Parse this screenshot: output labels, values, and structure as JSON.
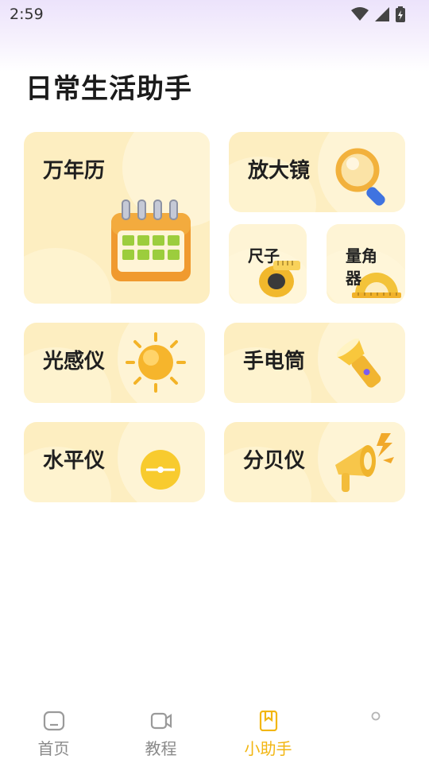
{
  "status_bar": {
    "time": "2:59",
    "icons": [
      "wifi-icon",
      "signal-icon",
      "battery-icon"
    ]
  },
  "page": {
    "title": "日常生活助手"
  },
  "tools": {
    "calendar": {
      "label": "万年历",
      "icon": "calendar-icon"
    },
    "magnifier": {
      "label": "放大镜",
      "icon": "magnifier-icon"
    },
    "ruler": {
      "label": "尺子",
      "icon": "tape-measure-icon"
    },
    "protractor": {
      "label": "量角器",
      "icon": "protractor-icon"
    },
    "light_meter": {
      "label": "光感仪",
      "icon": "sun-icon"
    },
    "flashlight": {
      "label": "手电筒",
      "icon": "flashlight-icon"
    },
    "level": {
      "label": "水平仪",
      "icon": "level-icon"
    },
    "decibel": {
      "label": "分贝仪",
      "icon": "megaphone-icon"
    }
  },
  "nav": {
    "items": [
      {
        "label": "首页",
        "icon": "home-icon"
      },
      {
        "label": "教程",
        "icon": "video-icon"
      },
      {
        "label": "小助手",
        "icon": "bookmark-icon",
        "active": true
      }
    ]
  },
  "colors": {
    "card_bg": "#fdeec1",
    "accent": "#f2b612"
  }
}
